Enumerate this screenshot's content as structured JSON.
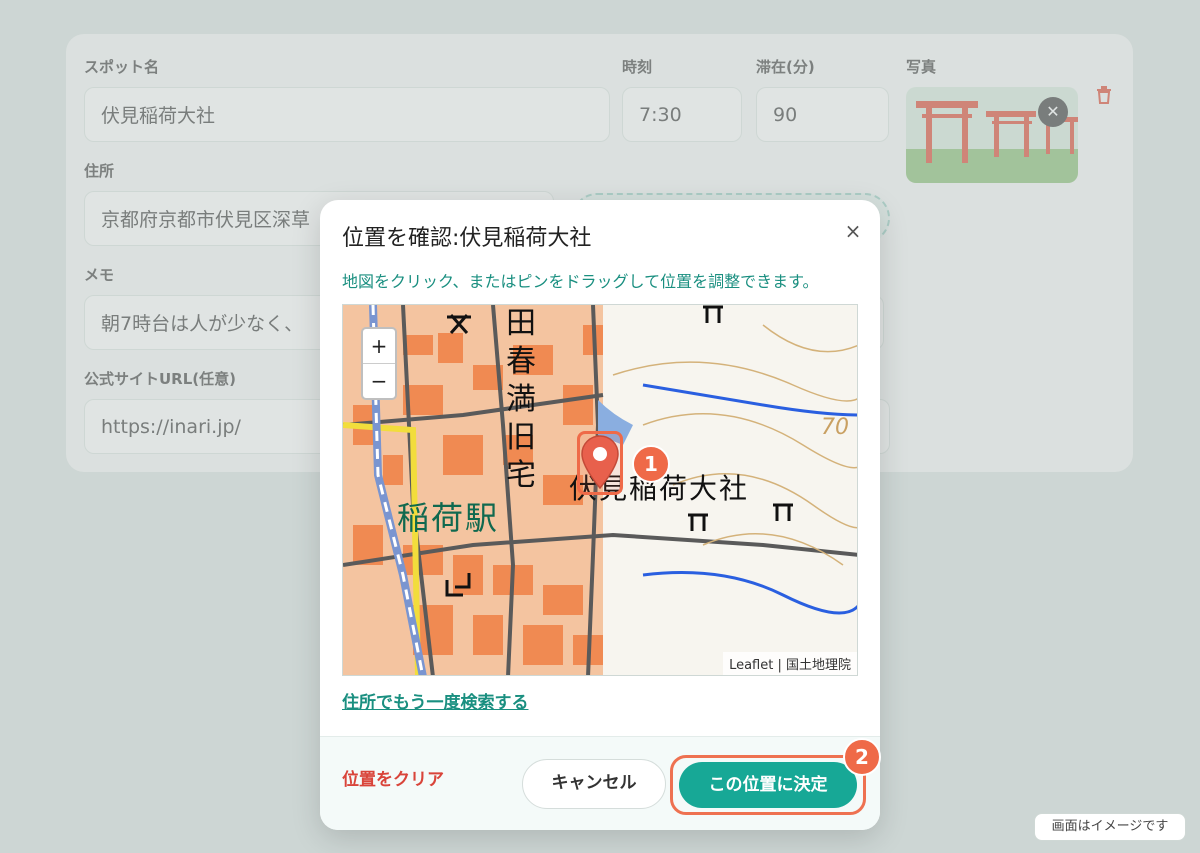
{
  "form": {
    "spot_label": "スポット名",
    "spot_value": "伏見稲荷大社",
    "time_label": "時刻",
    "time_value": "7:30",
    "stay_label": "滞在(分)",
    "stay_value": "90",
    "photo_label": "写真",
    "address_label": "住所",
    "address_value": "京都府京都市伏見区深草",
    "memo_label": "メモ",
    "memo_value": "朝7時台は人が少なく、",
    "url_label": "公式サイトURL(任意)",
    "url_value": "https://inari.jp/"
  },
  "modal": {
    "title": "位置を確認:伏見稲荷大社",
    "close_glyph": "×",
    "hint": "地図をクリック、またはピンをドラッグして位置を調整できます。",
    "map": {
      "zoom_in": "+",
      "zoom_out": "−",
      "attribution": "Leaflet | 国土地理院",
      "labels": {
        "shrine_name": "伏見稲荷大社",
        "station_name": "稲荷駅",
        "vertical_text": [
          "田",
          "春",
          "満",
          "旧",
          "宅"
        ],
        "contour_70": "70"
      }
    },
    "research_link": "住所でもう一度検索する",
    "clear_link": "位置をクリア",
    "cancel_label": "キャンセル",
    "confirm_label": "この位置に決定"
  },
  "badges": {
    "step1": "1",
    "step2": "2"
  },
  "colors": {
    "accent": "#17a896",
    "highlight": "#ee7151",
    "danger": "#d9443a",
    "pin": "#e8604c"
  },
  "note": "画面はイメージです"
}
